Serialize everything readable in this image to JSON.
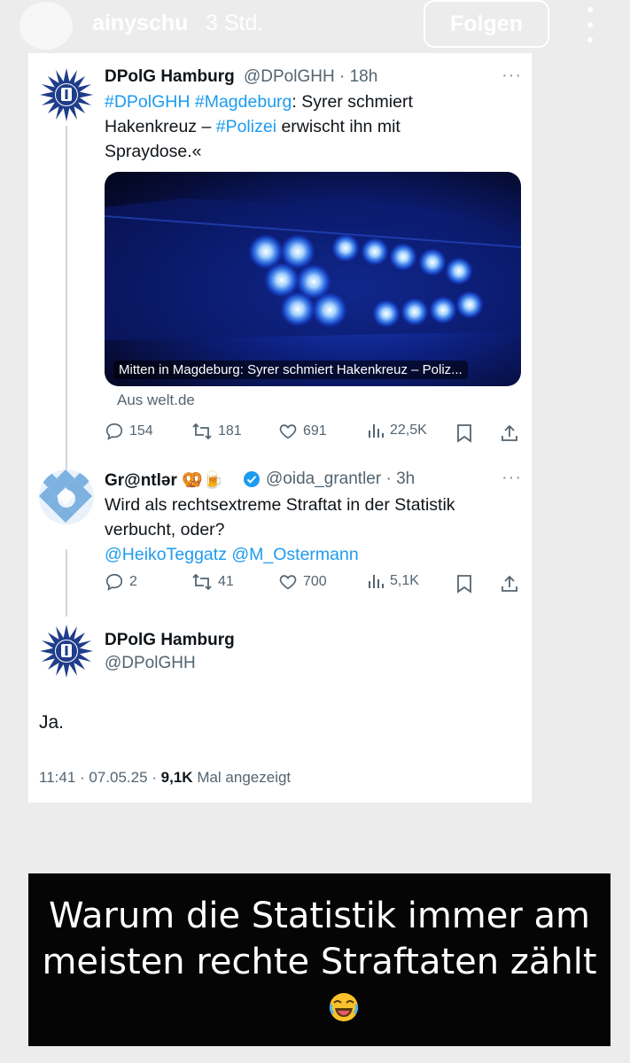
{
  "story": {
    "username": "ainyschu",
    "time": "3 Std.",
    "follow_label": "Folgen"
  },
  "tweet1": {
    "name": "DPolG Hamburg",
    "handle": "@DPolGHH · 18h",
    "text_line1_tag1": "#DPolGHH",
    "text_line1_tag2": "#Magdeburg",
    "text_line1_rest": ": Syrer schmiert",
    "text_line2_pre": "Hakenkreuz – ",
    "text_line2_tag": "#Polizei",
    "text_line2_rest": " erwischt ihn mit",
    "text_line3": "Spraydose.«",
    "media_caption": "Mitten in Magdeburg: Syrer schmiert Hakenkreuz – Poliz...",
    "source": "Aus welt.de",
    "replies": "154",
    "retweets": "181",
    "likes": "691",
    "views": "22,5K"
  },
  "tweet2": {
    "name": "Gr@ntlər 🥨🍺",
    "handle": "@oida_grantler · 3h",
    "line1": "Wird als rechtsextreme Straftat in der Statistik",
    "line2": "verbucht, oder?",
    "mentions": "@HeikoTeggatz @M_Ostermann",
    "replies": "2",
    "retweets": "41",
    "likes": "700",
    "views": "5,1K"
  },
  "tweet3": {
    "name": "DPolG Hamburg",
    "handle": "@DPolGHH",
    "text": "Ja.",
    "meta_pre": "11:41 · 07.05.25 · ",
    "meta_views": "9,1K",
    "meta_post": " Mal angezeigt"
  },
  "caption": {
    "line1": "Warum die Statistik immer am",
    "line2": "meisten rechte Straftaten zählt"
  },
  "colors": {
    "link": "#1d9bf0",
    "muted": "#536471",
    "verified": "#1d9bf0"
  },
  "icons": [
    "more-vert-icon",
    "reply-icon",
    "retweet-icon",
    "like-icon",
    "views-icon",
    "bookmark-icon",
    "share-icon",
    "verified-icon",
    "more-horizontal-icon",
    "laughing-emoji-icon"
  ]
}
